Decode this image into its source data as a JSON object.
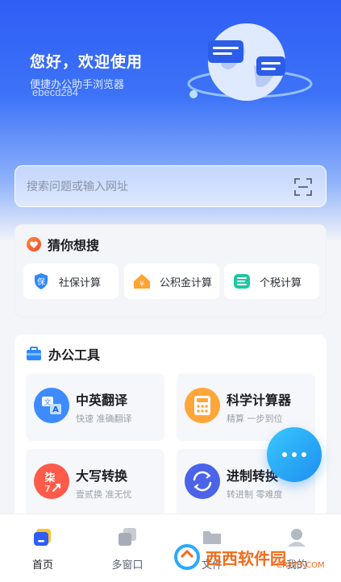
{
  "header": {
    "greeting": "您好，欢迎使用",
    "subtitle": "便捷办公助手浏览器",
    "watermark": "ebecd284"
  },
  "search": {
    "placeholder": "搜索问题或输入网址",
    "scan_icon": "scan-icon"
  },
  "guess": {
    "title": "猜你想搜",
    "items": [
      {
        "label": "社保计算",
        "icon": "shield-icon"
      },
      {
        "label": "公积金计算",
        "icon": "house-fund-icon"
      },
      {
        "label": "个税计算",
        "icon": "tax-icon"
      }
    ]
  },
  "office": {
    "title": "办公工具",
    "tools": [
      {
        "name": "中英翻译",
        "desc": "快速 准确翻译",
        "icon": "translate-icon"
      },
      {
        "name": "科学计算器",
        "desc": "精算 一步到位",
        "icon": "calculator-icon"
      },
      {
        "name": "大写转换",
        "desc": "壹贰换 准无忧",
        "icon": "uppercase-convert-icon"
      },
      {
        "name": "进制转换",
        "desc": "转进制 零难度",
        "icon": "base-convert-icon"
      }
    ]
  },
  "tabbar": {
    "items": [
      {
        "label": "首页",
        "active": true
      },
      {
        "label": "多窗口",
        "active": false
      },
      {
        "label": "文件",
        "active": false
      },
      {
        "label": "我的",
        "active": false
      }
    ]
  },
  "corner_logo": {
    "text": "西西软件园",
    "url": "CR173.COM"
  },
  "colors": {
    "primary": "#2f5ef6",
    "fab": "#1d8ff0",
    "accent_orange": "#f36b1b"
  }
}
